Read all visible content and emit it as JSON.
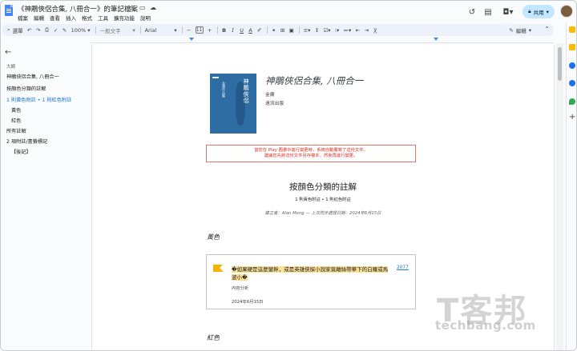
{
  "titlebar": {
    "doc_title": "《神鵰俠侶合集, 八冊合一》的筆記檔案",
    "menu": [
      "檔案",
      "編輯",
      "查看",
      "插入",
      "格式",
      "工具",
      "擴充功能",
      "說明"
    ],
    "share_label": "共用"
  },
  "toolbar": {
    "search_label": "選單",
    "zoom": "100%",
    "style": "一般文字",
    "font": "Arial",
    "font_size": "11",
    "mode_label": "編輯"
  },
  "outline": {
    "heading": "大綱",
    "items": [
      "神鵰俠侶合集, 八冊合一",
      "按顏色分類的註解",
      "1 則黃色附註 • 1 則紅色附註",
      "黃色",
      "紅色",
      "所有註解",
      "2 項附註/書籤標記",
      "【後記】"
    ]
  },
  "book": {
    "cover_title": "神鵰俠侶",
    "cover_author": "金庸",
    "cover_strip": "金庸作品集",
    "title": "神鵰俠侶合集, 八冊合一",
    "author": "金庸",
    "publisher": "遠流出版"
  },
  "warning": {
    "line1": "當您在 Play 圖書中進行變更時，系統自動覆寫了這份文件。",
    "line2": "建議您先將這份文件另存複本，然後再進行變更。"
  },
  "section": {
    "title": "按顏色分類的註解",
    "subtitle": "1 則黃色附註 • 1 則紅色附註",
    "meta": "建立者：Alan Meng — 上次同步處理日期：2024年6月15日"
  },
  "yellow_heading": "黃色",
  "red_heading": "紅色",
  "note": {
    "text": "�如果硬是這麼蠻幹，或是英雄俠探小說家竟離絲帶華下的白羅或馬波小�",
    "location": "2077",
    "sub": "內容分析",
    "date": "2024年6月15日",
    "flag_color": "#f6b400"
  },
  "watermark": {
    "cn": "T客邦",
    "en": "techbang.com"
  },
  "colors": {
    "accent": "#1a73e8",
    "share_bg": "#c2e7ff",
    "warning": "#d93025",
    "highlight": "#fde293",
    "cover": "#2e6da4"
  }
}
